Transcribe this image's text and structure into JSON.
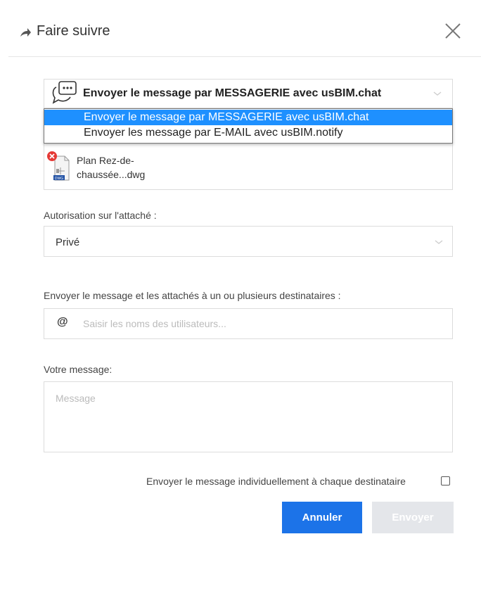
{
  "header": {
    "title": "Faire suivre"
  },
  "mode": {
    "selected": "Envoyer le message par MESSAGERIE avec usBIM.chat",
    "options": [
      "Envoyer le message par MESSAGERIE avec usBIM.chat",
      "Envoyer les message par E-MAIL avec usBIM.notify"
    ]
  },
  "attachment": {
    "name_line1": "Plan Rez-de-",
    "name_line2": "chaussée...dwg",
    "badge": "DWG"
  },
  "authorization": {
    "label": "Autorisation sur l'attaché :",
    "value": "Privé"
  },
  "recipients": {
    "label": "Envoyer le message et les attachés à un ou plusieurs destinataires :",
    "at_symbol": "@",
    "placeholder": "Saisir les noms des utilisateurs..."
  },
  "message": {
    "label": "Votre message:",
    "placeholder": "Message"
  },
  "individual": {
    "label": "Envoyer le message individuellement à chaque destinataire",
    "checked": false
  },
  "buttons": {
    "cancel": "Annuler",
    "send": "Envoyer"
  },
  "colors": {
    "primary": "#1c73e8",
    "highlight": "#1e90ff",
    "disabled": "#e4e6ea",
    "error": "#e53935"
  }
}
